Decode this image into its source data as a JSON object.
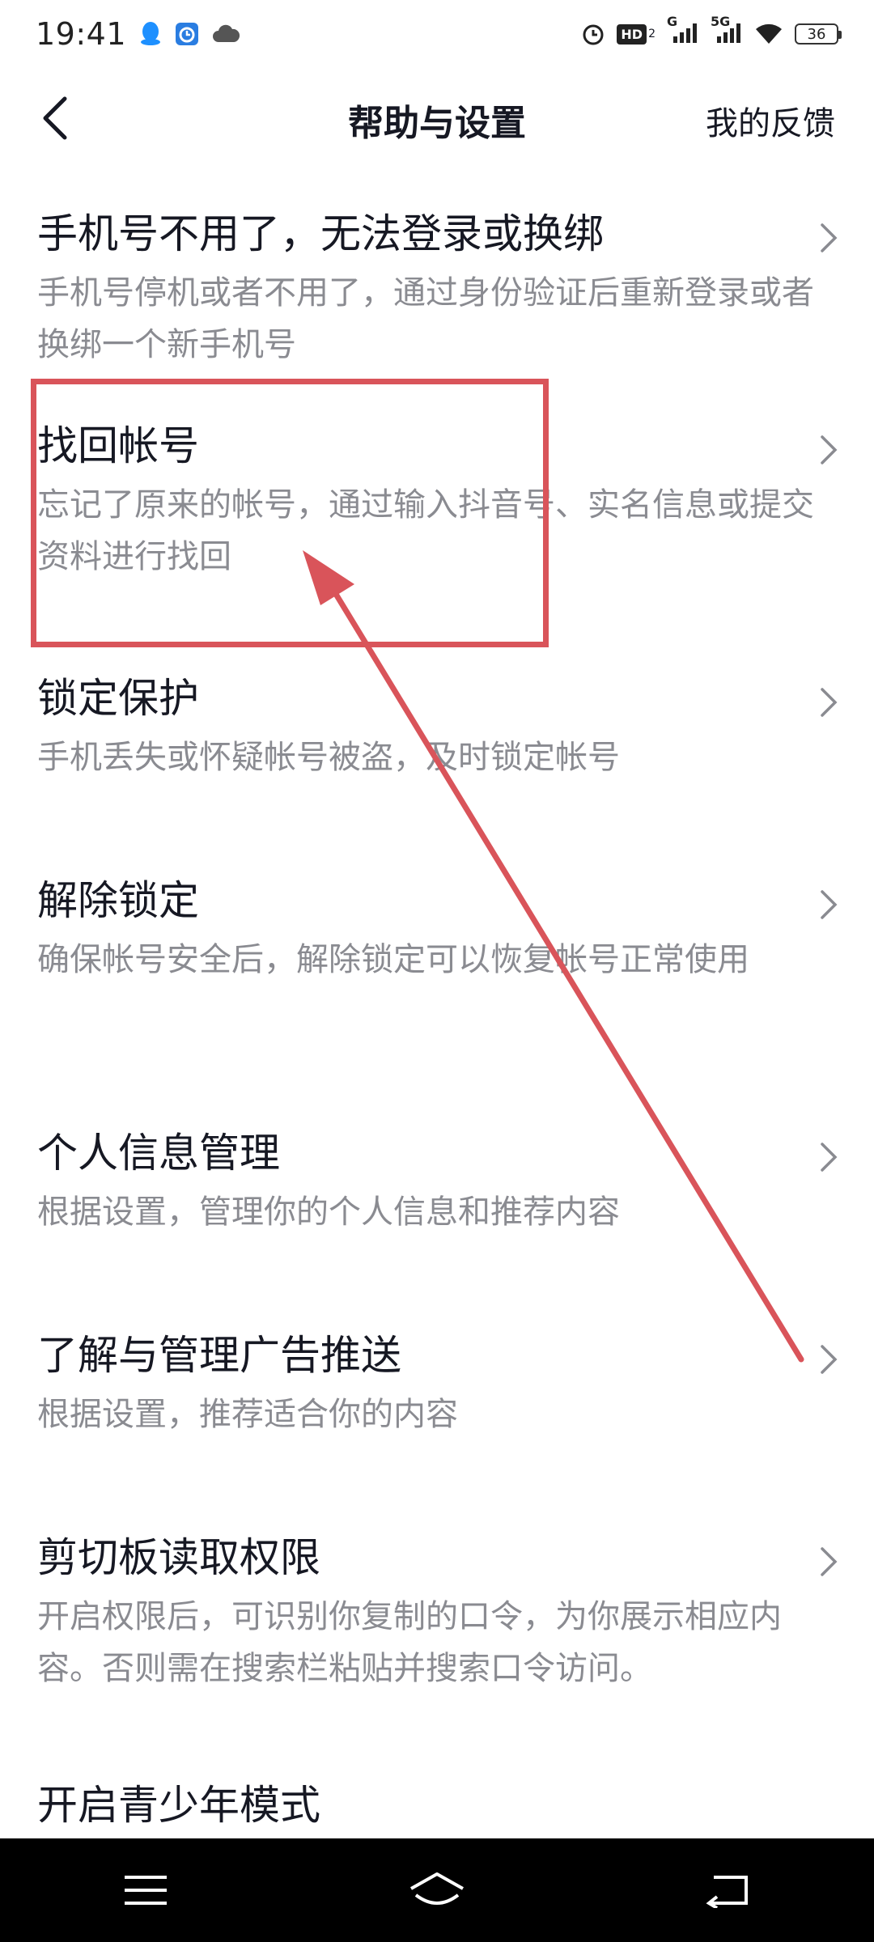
{
  "status_bar": {
    "time": "19:41",
    "left_icons": [
      "qq-icon",
      "alarm-app-icon",
      "cloud-icon"
    ],
    "right_icons": [
      "alarm-clock-icon",
      "hd-icon",
      "signal-g-icon",
      "signal-5g-icon",
      "wifi-icon"
    ],
    "signal_g_label": "G",
    "signal_5g_label": "5G",
    "hd_label": "HD",
    "hd_sub": "2",
    "battery_level": "36"
  },
  "header": {
    "title": "帮助与设置",
    "feedback": "我的反馈"
  },
  "items": [
    {
      "title": "手机号不用了，无法登录或换绑",
      "desc": "手机号停机或者不用了，通过身份验证后重新登录或者换绑一个新手机号"
    },
    {
      "title": "找回帐号",
      "desc": "忘记了原来的帐号，通过输入抖音号、实名信息或提交资料进行找回"
    },
    {
      "title": "锁定保护",
      "desc": "手机丢失或怀疑帐号被盗，及时锁定帐号"
    },
    {
      "title": "解除锁定",
      "desc": "确保帐号安全后，解除锁定可以恢复帐号正常使用"
    },
    {
      "title": "个人信息管理",
      "desc": "根据设置，管理你的个人信息和推荐内容"
    },
    {
      "title": "了解与管理广告推送",
      "desc": "根据设置，推荐适合你的内容"
    },
    {
      "title": "剪切板读取权限",
      "desc": "开启权限后，可识别你复制的口令，为你展示相应内容。否则需在搜索栏粘贴并搜索口令访问。"
    },
    {
      "title": "开启青少年模式",
      "desc": ""
    }
  ],
  "annotation": {
    "color": "#d9545a"
  },
  "nav_bar": {
    "buttons": [
      "menu-icon",
      "home-icon",
      "back-nav-icon"
    ]
  }
}
